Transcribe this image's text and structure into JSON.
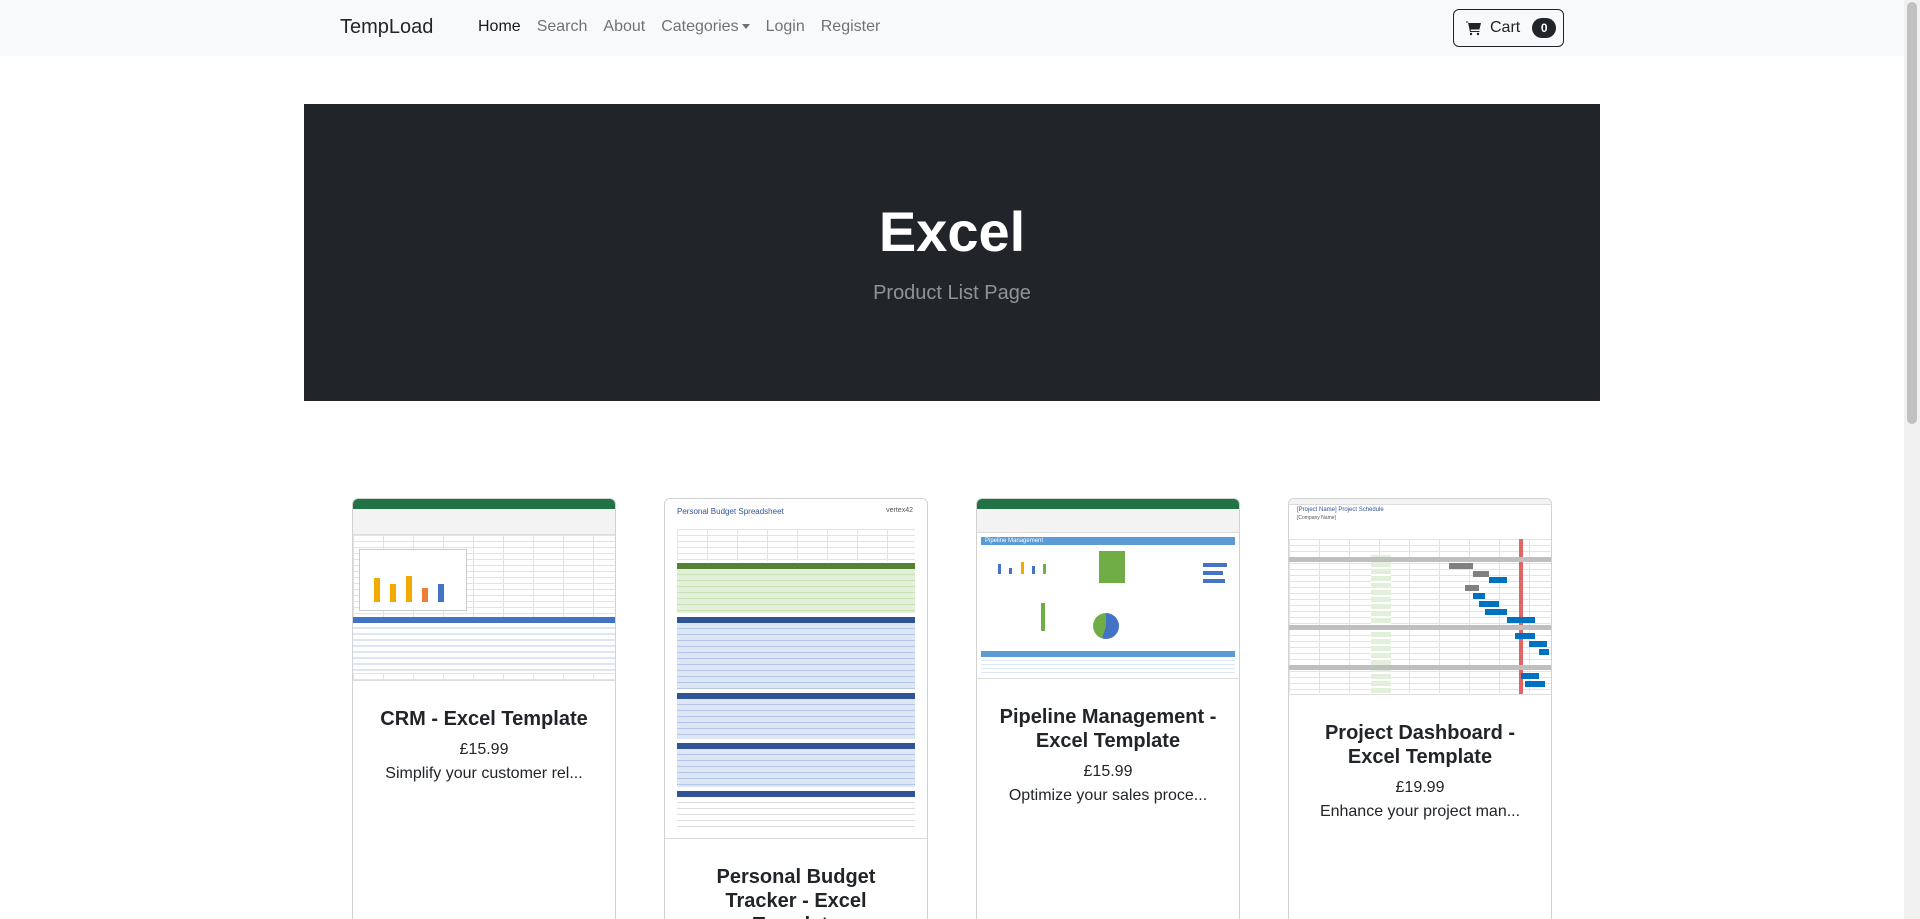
{
  "navbar": {
    "brand": "TempLoad",
    "items": [
      {
        "label": "Home"
      },
      {
        "label": "Search"
      },
      {
        "label": "About"
      },
      {
        "label": "Categories"
      },
      {
        "label": "Login"
      },
      {
        "label": "Register"
      }
    ],
    "cart_label": "Cart",
    "cart_count": "0",
    "cart_icon": "cart-icon"
  },
  "hero": {
    "title": "Excel",
    "subtitle": "Product List Page"
  },
  "products": [
    {
      "title": "CRM - Excel Template",
      "price": "£15.99",
      "desc": "Simplify your customer rel..."
    },
    {
      "title": "Personal Budget Tracker - Excel Template",
      "price": "",
      "desc": ""
    },
    {
      "title": "Pipeline Management - Excel Template",
      "price": "£15.99",
      "desc": "Optimize your sales proce..."
    },
    {
      "title": "Project Dashboard - Excel Template",
      "price": "£19.99",
      "desc": "Enhance your project man..."
    }
  ],
  "thumbnail_texts": {
    "budget_title": "Personal Budget Spreadsheet",
    "budget_logo": "vertex42",
    "pipeline_title": "Pipeline Management",
    "dashboard_title": "[Project Name] Project Schedule",
    "dashboard_company": "[Company Name]"
  },
  "colors": {
    "hero_bg": "#212529",
    "excel_green": "#217346",
    "navbar_bg": "#f8f9fa"
  }
}
